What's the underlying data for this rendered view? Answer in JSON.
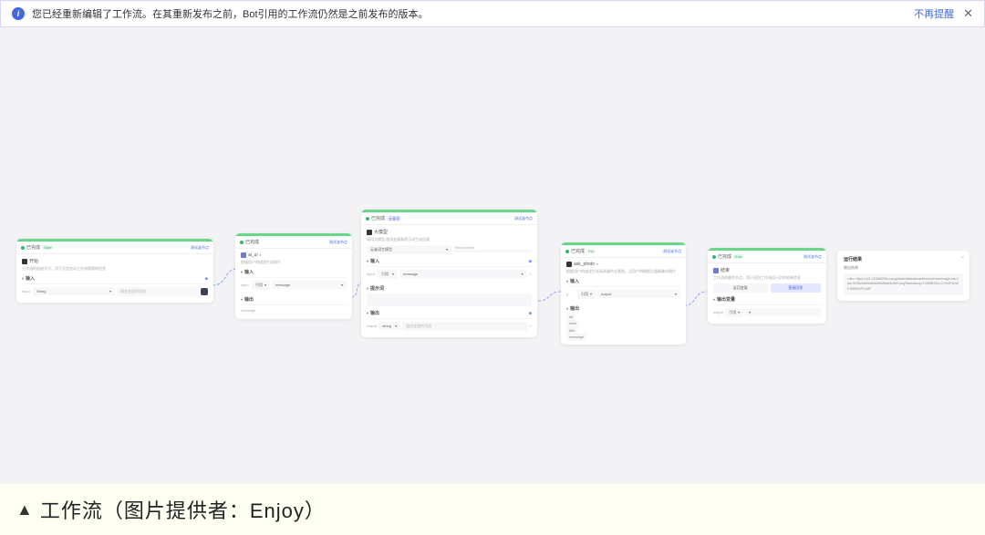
{
  "notification": {
    "text": "您已经重新编辑了工作流。在其重新发布之前，Bot引用的工作流仍然是之前发布的版本。",
    "dismiss": "不再提醒"
  },
  "caption": "工作流（图片提供者：Enjoy）",
  "nodes": {
    "start": {
      "header_name": "已完成",
      "header_tag": "Start",
      "action": "测试该节点",
      "title": "开始",
      "subtitle": "工作流的起始节点，用于设定启动工作流需要的信息",
      "section_input": "输入",
      "param_name": "input",
      "var_type": "String",
      "placeholder": "描述变量的用途"
    },
    "plugin1": {
      "header_name": "已完成",
      "action": "测试该节点",
      "title": "ai_ui",
      "subtitle": "根据用户的描述生成图片",
      "section_input": "输入",
      "param_input": "input",
      "select_ref": "引用",
      "select_msg": "message",
      "section_output": "输出",
      "out_msg": "message"
    },
    "llm": {
      "header_name": "已完成",
      "header_tag": "云雀语",
      "action": "测试该节点",
      "title": "大模型",
      "subtitle": "调用大模型,使用变量和提示词生成回复",
      "model_label": "云雀语言模型",
      "temp_label": "Temperature",
      "section_input": "输入",
      "param_input": "input",
      "select_ref": "引用",
      "select_msg": "message",
      "section_prompt": "提示词",
      "section_output": "输出",
      "out_param": "output",
      "out_type": "string",
      "placeholder": "描述变量的用途"
    },
    "plugin2": {
      "header_name": "已完成",
      "header_tag": "DuI",
      "action": "测试该节点",
      "title": "ask_photo",
      "subtitle": "根据用户的描述生成高质量的全景图。当用户明确提出看精美的图片",
      "section_input": "输入",
      "param_p": "p",
      "select_ref": "引用",
      "select_out": "output",
      "section_output": "输出",
      "out_a": "alt",
      "out_d": "data",
      "out_t": "title",
      "out_m": "message"
    },
    "end": {
      "header_name": "已完成",
      "header_tag": "End",
      "action": "测试该节点",
      "title": "结束",
      "subtitle": "工作流的最终节点，用于返回工作流运行后的结果信息",
      "opt1": "返回变量",
      "opt2": "直接回答",
      "section_output": "输出变量",
      "param_out": "output",
      "select_ref": "引用"
    },
    "result": {
      "title": "运行结果",
      "subtitle": "输出结果",
      "content": "<div> https://s21-123456789.coa.jp/static/labs/abcdef/xxxxxx/xxxx/image-cat-Cats-9234c0ad5ed5de5f4c5baf3c5e0.png?timestamp=1234567&x=2.0%2Fw%2F1080%2Fh%2F"
    }
  }
}
